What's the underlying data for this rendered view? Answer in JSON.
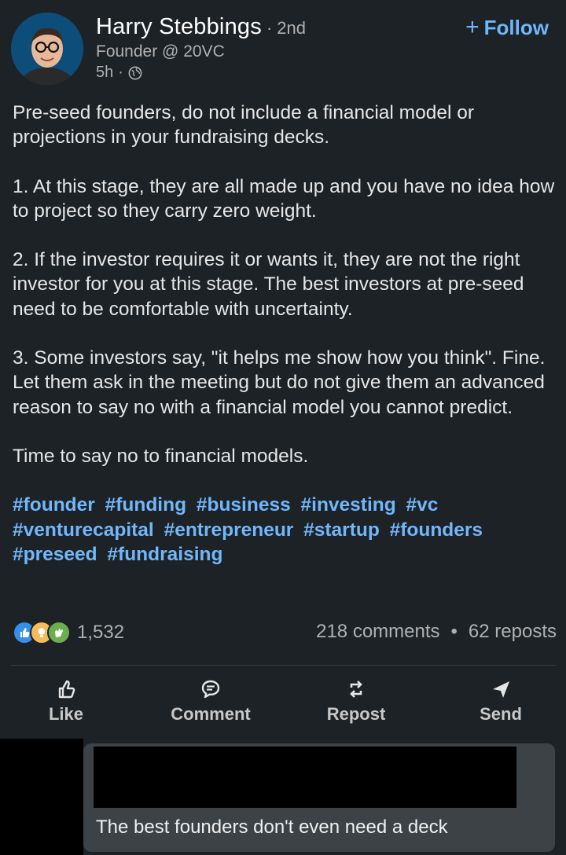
{
  "author": {
    "name": "Harry Stebbings",
    "degree": "2nd",
    "headline": "Founder @ 20VC",
    "time": "5h",
    "visibility_icon": "globe-icon"
  },
  "follow_label": "Follow",
  "post": {
    "paragraphs": [
      "Pre-seed founders, do not include a financial model or projections in your fundraising decks.",
      "1. At this stage, they are all made up and you have no idea how to project so they carry zero weight.",
      "2. If the investor requires it or wants it, they are not the right investor for you at this stage. The best investors at pre-seed need to be comfortable with uncertainty.",
      "3. Some investors say, \"it helps me show how you think\". Fine. Let them ask in the meeting but do not give them an advanced reason to say no with a financial model you cannot predict.",
      "Time to say no to financial models."
    ],
    "hashtags": [
      "#founder",
      "#funding",
      "#business",
      "#investing",
      "#vc",
      "#venturecapital",
      "#entrepreneur",
      "#startup",
      "#founders",
      "#preseed",
      "#fundraising"
    ]
  },
  "stats": {
    "reaction_count": "1,532",
    "comments": "218 comments",
    "separator": "•",
    "reposts": "62 reposts"
  },
  "actions": {
    "like": "Like",
    "comment": "Comment",
    "repost": "Repost",
    "send": "Send"
  },
  "comment_preview": {
    "text": "The best founders don't even need a deck"
  },
  "colors": {
    "background": "#1d2226",
    "link": "#71b7fb",
    "text": "#e6e6e6",
    "muted": "#b0b0b0"
  }
}
